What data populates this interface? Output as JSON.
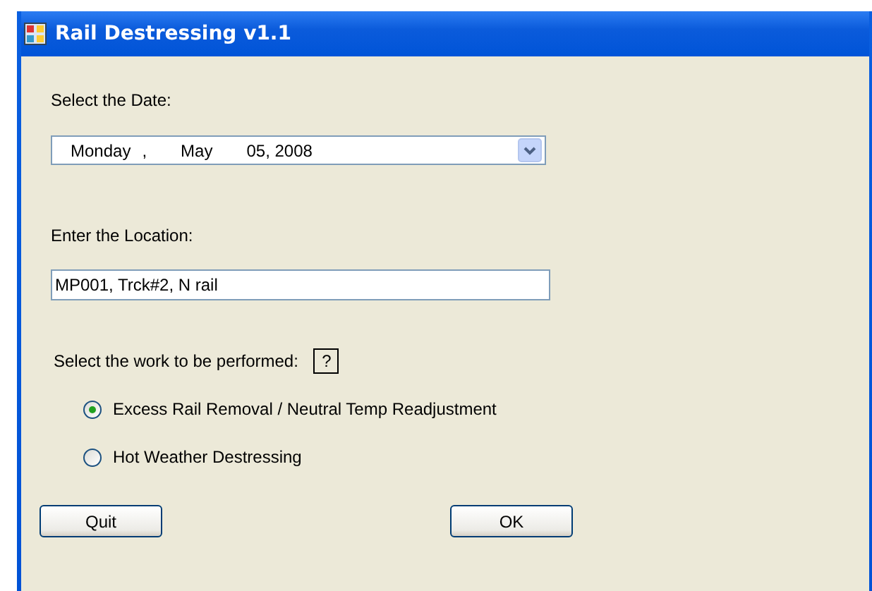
{
  "window": {
    "title": "Rail Destressing v1.1"
  },
  "date": {
    "label": "Select the Date:",
    "parts": [
      "Monday",
      ",",
      "May",
      "05, 2008"
    ]
  },
  "location": {
    "label": "Enter the Location:",
    "value": "MP001, Trck#2, N rail"
  },
  "work": {
    "label": "Select the work to be performed:",
    "help": "?",
    "options": [
      {
        "label": "Excess Rail Removal / Neutral Temp Readjustment",
        "selected": true
      },
      {
        "label": "Hot Weather Destressing",
        "selected": false
      }
    ]
  },
  "buttons": [
    {
      "label": "Quit"
    },
    {
      "label": "OK"
    }
  ]
}
